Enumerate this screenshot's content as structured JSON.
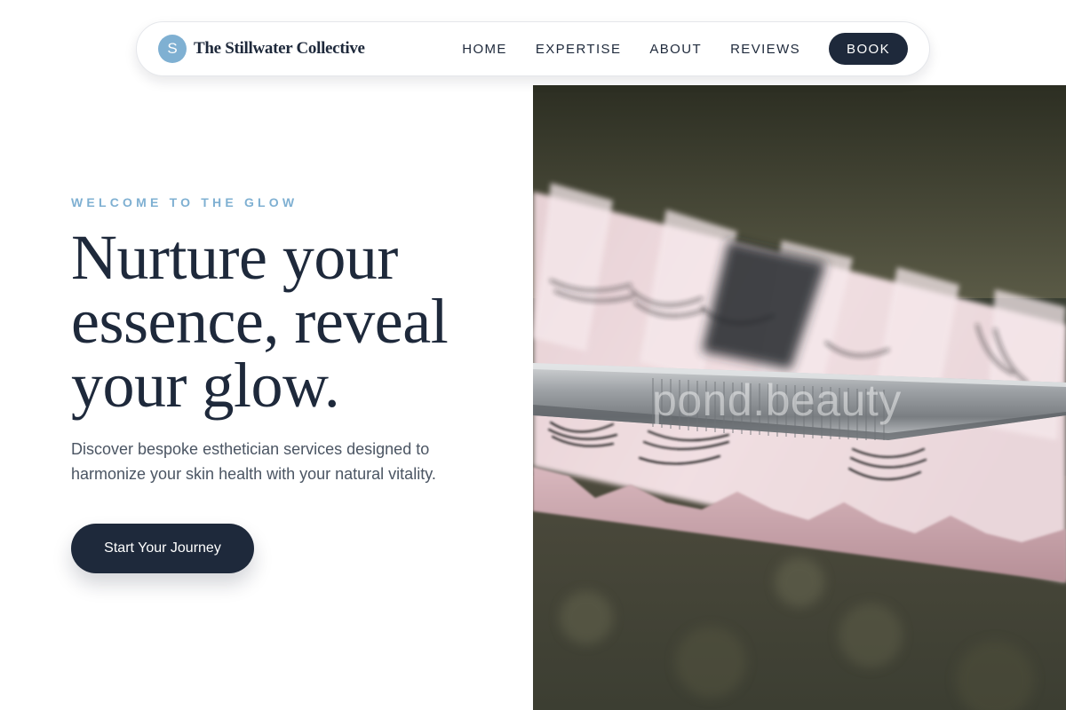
{
  "brand": {
    "initial": "S",
    "name": "The Stillwater Collective"
  },
  "nav": {
    "links": [
      "HOME",
      "EXPERTISE",
      "ABOUT",
      "REVIEWS"
    ],
    "book_label": "BOOK"
  },
  "hero": {
    "eyebrow": "WELCOME TO THE GLOW",
    "headline_lines": [
      "Nurture your",
      "essence, reveal",
      "your glow."
    ],
    "subtext": "Discover bespoke esthetician services designed to harmonize your skin health with your natural vitality.",
    "cta_label": "Start Your Journey"
  },
  "image": {
    "subject": "eyelash-extension-tray-with-tweezers",
    "watermark": "pond.beauty"
  },
  "colors": {
    "navy": "#1e293b",
    "accent_blue": "#7fb0d2",
    "body_text": "#4b5563",
    "background": "#ffffff"
  }
}
